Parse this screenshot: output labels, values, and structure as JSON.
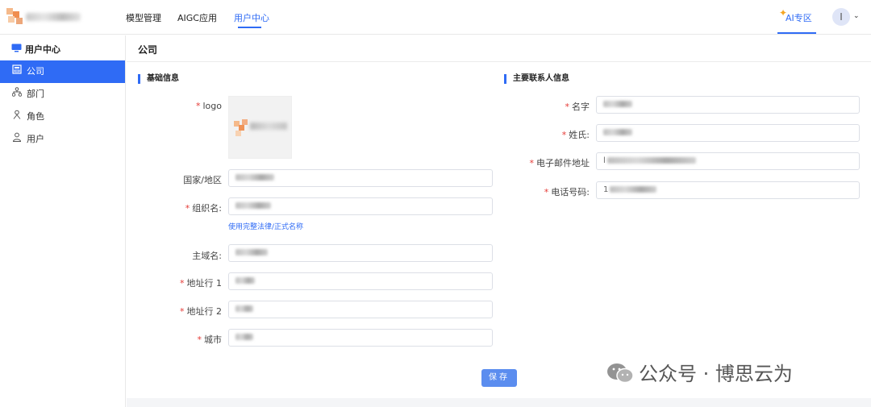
{
  "header": {
    "nav": [
      {
        "label": "模型管理"
      },
      {
        "label": "AIGC应用"
      },
      {
        "label": "用户中心",
        "active": true
      }
    ],
    "ai_zone_label": "AI专区",
    "avatar_initial": "I"
  },
  "sidebar": {
    "title": "用户中心",
    "items": [
      {
        "label": "公司",
        "icon": "building-icon",
        "active": true
      },
      {
        "label": "部门",
        "icon": "org-chart-icon"
      },
      {
        "label": "角色",
        "icon": "role-icon"
      },
      {
        "label": "用户",
        "icon": "user-icon"
      }
    ]
  },
  "main": {
    "title": "公司",
    "basic": {
      "section_title": "基础信息",
      "logo_label": "logo",
      "country_label": "国家/地区",
      "org_label": "组织名:",
      "org_hint": "使用完整法律/正式名称",
      "domain_label": "主域名:",
      "addr1_label": "地址行 1",
      "addr2_label": "地址行 2",
      "city_label": "城市"
    },
    "contact": {
      "section_title": "主要联系人信息",
      "firstname_label": "名字",
      "lastname_label": "姓氏:",
      "email_label": "电子邮件地址",
      "email_prefix": "l",
      "phone_label": "电话号码:",
      "phone_prefix": "1"
    },
    "save_label": "保存"
  },
  "watermark": {
    "text": "公众号 · 博思云为"
  },
  "colors": {
    "accent": "#2f6bf5",
    "required": "#e53935",
    "save_button": "#5b8def"
  }
}
